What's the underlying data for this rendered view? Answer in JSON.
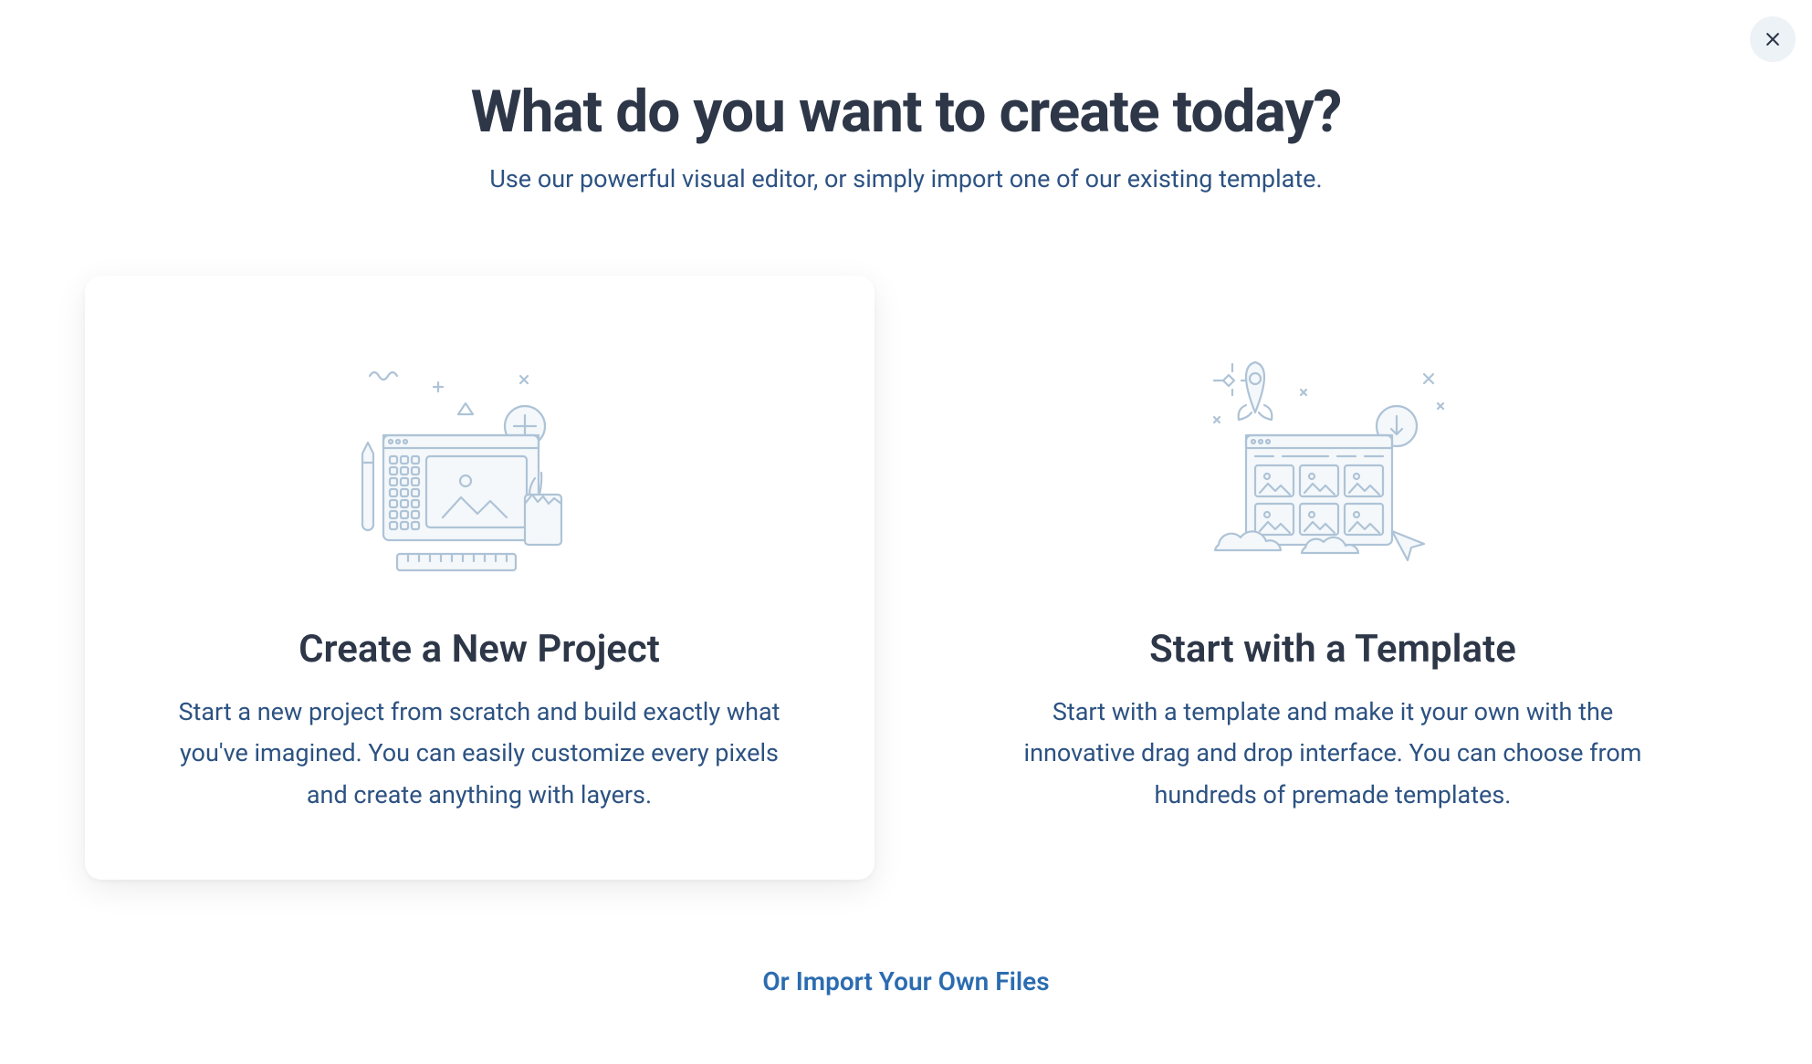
{
  "header": {
    "title": "What do you want to create today?",
    "subtitle": "Use our powerful visual editor, or simply import one of our existing template."
  },
  "options": {
    "new_project": {
      "title": "Create a New Project",
      "description": "Start a new project from scratch and build exactly what you've imagined. You can easily customize every pixels and create anything with layers."
    },
    "template": {
      "title": "Start with a Template",
      "description": "Start with a template and make it your own with the innovative drag and drop interface. You can choose from hundreds of premade templates."
    }
  },
  "footer": {
    "import_link": "Or Import Your Own Files"
  }
}
